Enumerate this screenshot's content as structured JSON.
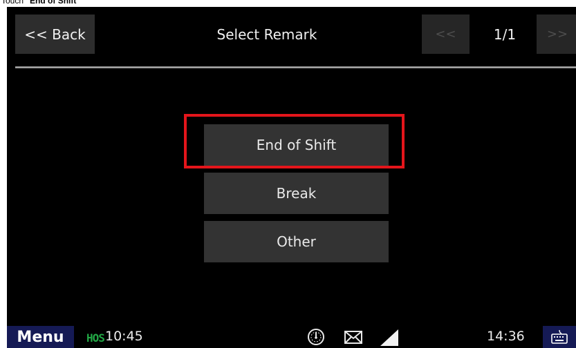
{
  "caption": {
    "prefix": "Touch ",
    "target": "\"End of Shift\""
  },
  "header": {
    "back_label": "<< Back",
    "title": "Select Remark",
    "prev_label": "<<",
    "page_indicator": "1/1",
    "next_label": ">>"
  },
  "remarks": [
    {
      "label": "End of Shift",
      "highlighted": true
    },
    {
      "label": "Break",
      "highlighted": false
    },
    {
      "label": "Other",
      "highlighted": false
    }
  ],
  "statusbar": {
    "menu_label": "Menu",
    "hos_badge": "HOS",
    "hos_time": "10:45",
    "clock": "14:36",
    "icons": [
      "speedometer-icon",
      "envelope-icon",
      "signal-strength-icon",
      "keyboard-icon"
    ]
  },
  "colors": {
    "highlight": "#e4151b",
    "statusbar_button": "#151a55",
    "hos_green": "#22a745"
  }
}
